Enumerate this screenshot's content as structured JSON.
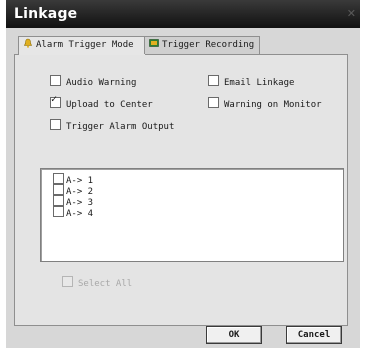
{
  "window": {
    "title": "Linkage"
  },
  "tabs": [
    {
      "label": "Alarm Trigger Mode",
      "icon": "alarm-bell-icon",
      "active": true
    },
    {
      "label": "Trigger Recording",
      "icon": "record-film-icon",
      "active": false
    }
  ],
  "options": {
    "audio_warning": {
      "label": "Audio Warning",
      "checked": false
    },
    "email_linkage": {
      "label": "Email Linkage",
      "checked": false
    },
    "upload_to_center": {
      "label": "Upload to Center",
      "checked": true
    },
    "warning_on_monitor": {
      "label": "Warning on Monitor",
      "checked": false
    },
    "trigger_alarm_output": {
      "label": "Trigger Alarm Output",
      "checked": false
    }
  },
  "output_list": [
    {
      "label": "A-> 1",
      "checked": false
    },
    {
      "label": "A-> 2",
      "checked": false
    },
    {
      "label": "A-> 3",
      "checked": false
    },
    {
      "label": "A-> 4",
      "checked": false
    }
  ],
  "select_all": {
    "label": "Select All",
    "enabled": false
  },
  "buttons": {
    "ok": "OK",
    "cancel": "Cancel"
  },
  "colors": {
    "titlebar": "#1a1a1a",
    "dialog_bg": "#d7d7d7",
    "tab_icon_alarm": "#e0b020",
    "tab_icon_record": "#2e7d32"
  }
}
